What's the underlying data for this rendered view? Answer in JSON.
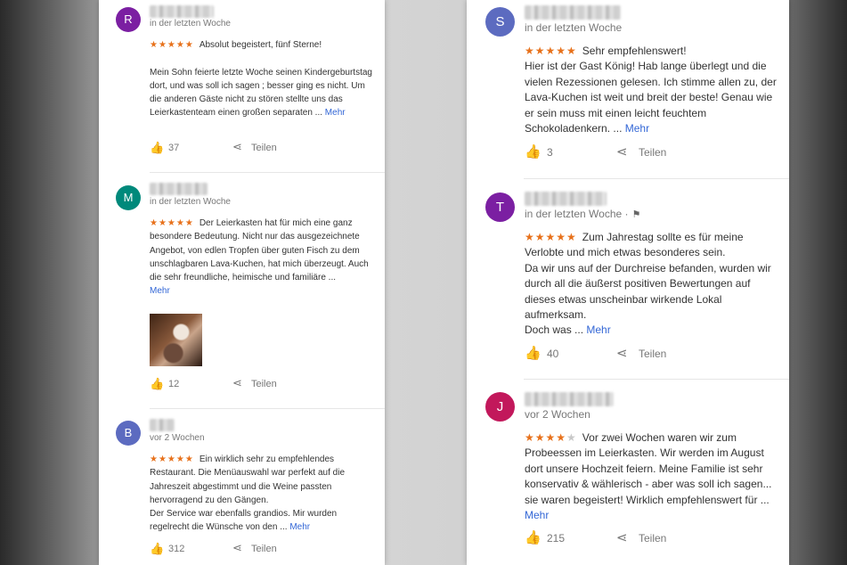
{
  "actions": {
    "share_label": "Teilen",
    "more_label": "Mehr"
  },
  "colors": {
    "star": "#e7711b",
    "link": "#3367d6"
  },
  "icons": {
    "like": "thumb-up-icon",
    "share": "share-icon",
    "flag": "flag-icon"
  },
  "left_reviews": [
    {
      "initial": "R",
      "avatar_color": "#7b1fa2",
      "time": "in der letzten Woche",
      "stars": "★★★★★",
      "headline": "Absolut begeistert, fünf Sterne!",
      "body": "Mein Sohn feierte letzte Woche seinen Kindergeburtstag dort,  und was soll ich sagen  ; besser ging es nicht. Um die anderen Gäste nicht zu stören stellte uns das Leierkastenteam einen großen separaten ...",
      "likes": "37"
    },
    {
      "initial": "M",
      "avatar_color": "#00897b",
      "time": "in der letzten Woche",
      "stars": "★★★★★",
      "headline": "Der Leierkasten hat für mich eine ganz besondere Bedeutung. Nicht nur das ausgezeichnete Angebot, von edlen Tropfen über guten Fisch zu dem unschlagbaren Lava-Kuchen, hat mich überzeugt. Auch die sehr freundliche, heimische und familiäre ...",
      "body": "",
      "likes": "12"
    },
    {
      "initial": "B",
      "avatar_color": "#5c6bc0",
      "time": "vor 2 Wochen",
      "stars": "★★★★★",
      "headline": "Ein wirklich sehr zu empfehlendes Restaurant. Die Menüauswahl war perfekt auf die Jahreszeit abgestimmt und die Weine passten hervorragend zu den Gängen.",
      "body": "Der Service war ebenfalls grandios. Mir wurden regelrecht die Wünsche von den ...",
      "likes": "312"
    }
  ],
  "right_reviews": [
    {
      "initial": "S",
      "avatar_color": "#5c6bc0",
      "time": "in der letzten Woche",
      "stars": "★★★★★",
      "headline": "Sehr empfehlenswert!",
      "body": "Hier ist der Gast König! Hab lange überlegt und die vielen Rezessionen gelesen. Ich stimme allen zu, der Lava-Kuchen ist weit und breit der beste! Genau wie er sein muss mit einen leicht feuchtem Schokoladenkern. ...",
      "likes": "3"
    },
    {
      "initial": "T",
      "avatar_color": "#7b1fa2",
      "time": "in der letzten Woche ·",
      "stars": "★★★★★",
      "headline": "Zum Jahrestag sollte es für meine Verlobte und mich etwas besonderes sein.",
      "body": "Da wir uns auf der Durchreise befanden, wurden wir durch all die äußerst positiven Bewertungen auf dieses etwas unscheinbar wirkende Lokal aufmerksam.",
      "tail": "Doch was ...",
      "likes": "40"
    },
    {
      "initial": "J",
      "avatar_color": "#c2185b",
      "time": "vor 2 Wochen",
      "stars": "★★★★",
      "stars_empty": "★",
      "headline": "Vor zwei Wochen waren wir zum Probeessen im Leierkasten. Wir werden im August dort unsere Hochzeit feiern. Meine Familie ist sehr konservativ & wählerisch - aber was soll ich sagen... sie waren begeistert! Wirklich empfehlenswert für ...",
      "body": "",
      "likes": "215"
    }
  ]
}
